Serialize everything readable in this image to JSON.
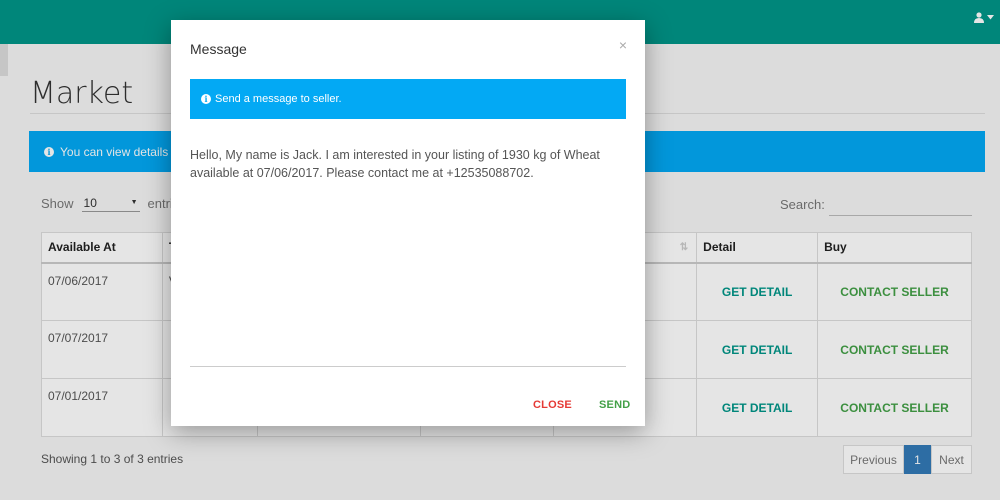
{
  "page": {
    "title": "Market",
    "info_text": "You can view details ab",
    "show_label": "Show",
    "entries_value": "10",
    "entries_suffix": "entri",
    "search_label": "Search:",
    "table": {
      "headers": [
        "Available At",
        "T",
        "",
        "",
        "",
        "Detail",
        "Buy"
      ],
      "rows": [
        {
          "available_at": "07/06/2017",
          "col2": "V",
          "detail": "GET DETAIL",
          "buy": "CONTACT SELLER"
        },
        {
          "available_at": "07/07/2017",
          "col2": "",
          "detail": "GET DETAIL",
          "buy": "CONTACT SELLER"
        },
        {
          "available_at": "07/01/2017",
          "col2": "",
          "detail": "GET DETAIL",
          "buy": "CONTACT SELLER"
        }
      ]
    },
    "showing_text": "Showing 1 to 3 of 3 entries",
    "pager": {
      "previous": "Previous",
      "current": "1",
      "next": "Next"
    }
  },
  "modal": {
    "title": "Message",
    "close_glyph": "×",
    "info_text": "Send a message to seller.",
    "message": "Hello, My name is Jack. I am interested in your listing of 1930 kg of Wheat\navailable at 07/06/2017. Please contact me at +12535088702.",
    "close_label": "CLOSE",
    "send_label": "SEND"
  },
  "colors": {
    "topbar": "#009688",
    "info": "#03a9f4",
    "close": "#e53935",
    "send": "#43a047",
    "pager_active": "#337ab7"
  }
}
